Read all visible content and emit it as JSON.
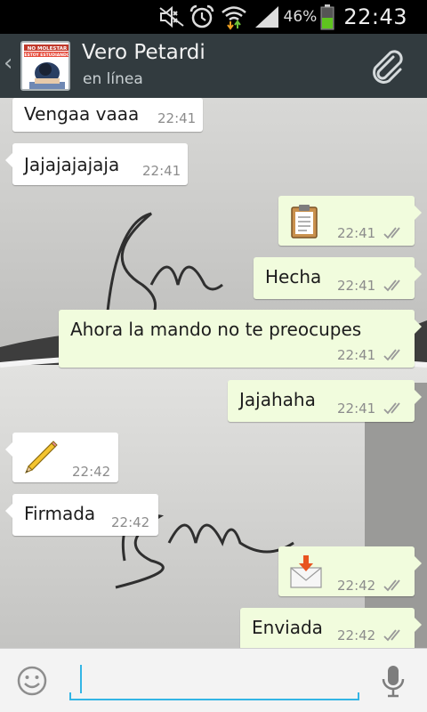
{
  "status_bar": {
    "battery_percent": "46%",
    "time": "22:43",
    "icons": [
      "mute-icon",
      "alarm-icon",
      "wifi-icon",
      "signal-icon",
      "battery-icon"
    ]
  },
  "header": {
    "contact_name": "Vero Petardi",
    "contact_status": "en línea",
    "avatar_text": [
      "NO MOLESTAR",
      "ESTOY ESTUDIANDO"
    ]
  },
  "messages": [
    {
      "direction": "in",
      "type": "text",
      "text": "Vengaa vaaa",
      "time": "22:41"
    },
    {
      "direction": "in",
      "type": "text",
      "text": "Jajajajajaja",
      "time": "22:41"
    },
    {
      "direction": "out",
      "type": "attachment",
      "icon": "clipboard-icon",
      "time": "22:41",
      "read": true
    },
    {
      "direction": "out",
      "type": "text",
      "text": "Hecha",
      "time": "22:41",
      "read": true
    },
    {
      "direction": "out",
      "type": "text",
      "text": "Ahora la mando no te preocupes",
      "time": "22:41",
      "read": true
    },
    {
      "direction": "out",
      "type": "text",
      "text": "Jajahaha",
      "time": "22:41",
      "read": true
    },
    {
      "direction": "in",
      "type": "attachment",
      "icon": "pencil-icon",
      "time": "22:42"
    },
    {
      "direction": "in",
      "type": "text",
      "text": "Firmada",
      "time": "22:42"
    },
    {
      "direction": "out",
      "type": "attachment",
      "icon": "mail-download-icon",
      "time": "22:42",
      "read": true
    },
    {
      "direction": "out",
      "type": "text",
      "text": "Enviada",
      "time": "22:42",
      "read": true
    }
  ],
  "input": {
    "value": "",
    "placeholder": ""
  },
  "colors": {
    "header_bg": "#323b3f",
    "incoming_bubble": "#ffffff",
    "outgoing_bubble": "#f1fcdd",
    "input_accent": "#33b5e5",
    "battery_green": "#5fc41f"
  }
}
